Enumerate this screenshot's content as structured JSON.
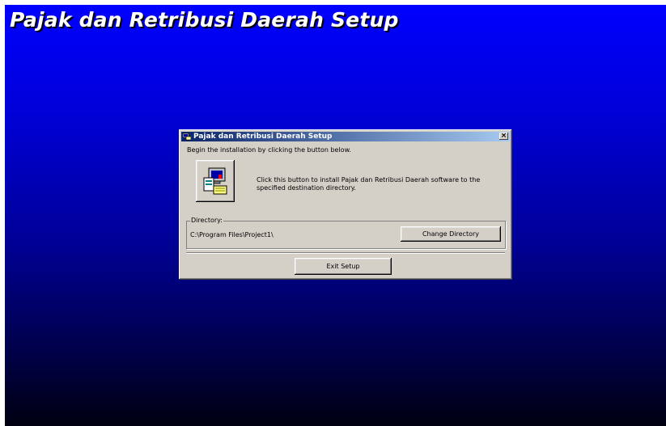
{
  "background": {
    "title": "Pajak dan Retribusi Daerah Setup",
    "gradient_top": "#0000ff",
    "gradient_bottom": "#000010"
  },
  "dialog": {
    "title": "Pajak dan Retribusi Daerah Setup",
    "close_glyph": "×",
    "intro": "Begin the installation by clicking the button below.",
    "install_button_icon": "computer-setup-icon",
    "install_description": "Click this button to install Pajak dan Retribusi Daerah software to the specified destination directory.",
    "directory_label": "Directory:",
    "directory_path": "C:\\Program Files\\Project1\\",
    "change_directory_label": "Change Directory",
    "exit_label": "Exit Setup",
    "title_bar_color": "#0a246a",
    "face_color": "#d4d0c8"
  }
}
